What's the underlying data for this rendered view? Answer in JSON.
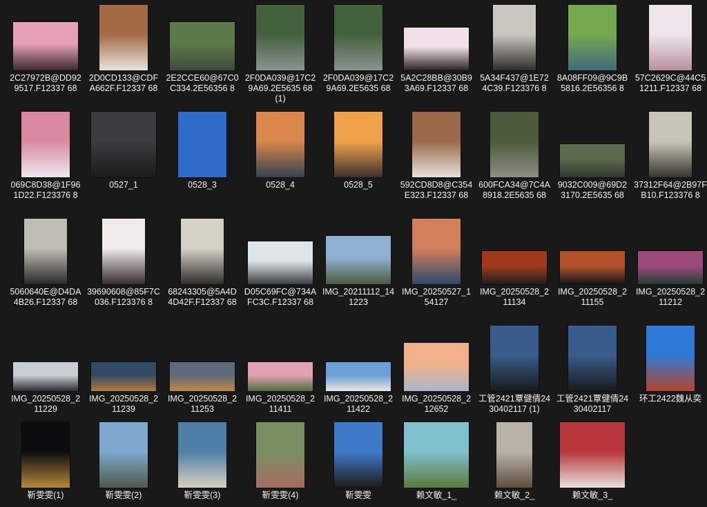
{
  "files": [
    {
      "name": "2C27972B@DD929517.F12337 68",
      "thumb": "photo-thumbnail",
      "colors": [
        "#e7a1b5",
        "#3a2a2a"
      ]
    },
    {
      "name": "2D0CD133@CDFA662F.F12337 68",
      "thumb": "photo-thumbnail",
      "colors": [
        "#a36a45",
        "#e9e3dc"
      ]
    },
    {
      "name": "2E2CCE60@67C0C334.2E56356 8",
      "thumb": "photo-thumbnail",
      "colors": [
        "#5d7a4a",
        "#3f4b3b"
      ]
    },
    {
      "name": "2F0DA039@17C29A69.2E5635 68 (1)",
      "thumb": "photo-thumbnail",
      "colors": [
        "#44613d",
        "#8a938e"
      ]
    },
    {
      "name": "2F0DA039@17C29A69.2E5635 68",
      "thumb": "photo-thumbnail",
      "colors": [
        "#44613d",
        "#8a938e"
      ]
    },
    {
      "name": "5A2C28BB@30B93A69.F12337 68",
      "thumb": "photo-thumbnail",
      "colors": [
        "#f3dfe7",
        "#2c2426"
      ]
    },
    {
      "name": "5A34F437@1E724C39.F123376 8",
      "thumb": "photo-thumbnail",
      "colors": [
        "#c9c7bf",
        "#2e2e2c"
      ]
    },
    {
      "name": "8A08FF09@9C9B5816.2E56356 8",
      "thumb": "photo-thumbnail",
      "colors": [
        "#76a84f",
        "#3f6b7a"
      ]
    },
    {
      "name": "57C2629C@44C51211.F12337 68",
      "thumb": "photo-thumbnail",
      "colors": [
        "#eee6ea",
        "#b98fa0"
      ]
    },
    {
      "name": "069C8D38@1F961D22.F123376 8",
      "thumb": "photo-thumbnail",
      "colors": [
        "#d98aa0",
        "#efe8ef"
      ]
    },
    {
      "name": "0527_1",
      "thumb": "photo-thumbnail",
      "colors": [
        "#3a3c3d",
        "#1a1b1b"
      ]
    },
    {
      "name": "0528_3",
      "thumb": "photo-thumbnail",
      "colors": [
        "#2f6bc8",
        "#2f6bc8"
      ]
    },
    {
      "name": "0528_4",
      "thumb": "photo-thumbnail",
      "colors": [
        "#d9874a",
        "#34424f"
      ]
    },
    {
      "name": "0528_5",
      "thumb": "photo-thumbnail",
      "colors": [
        "#f0a24a",
        "#3c3030"
      ]
    },
    {
      "name": "592CD8D8@C354E323.F12337 68",
      "thumb": "photo-thumbnail",
      "colors": [
        "#9b6a4a",
        "#e6e1dc"
      ]
    },
    {
      "name": "600FCA34@7C4A8918.2E5635 68",
      "thumb": "photo-thumbnail",
      "colors": [
        "#4e5a3c",
        "#8b8f84"
      ]
    },
    {
      "name": "9032C009@69D23170.2E5635 68",
      "thumb": "photo-thumbnail",
      "colors": [
        "#5c6a4d",
        "#2f3830"
      ]
    },
    {
      "name": "37312F64@2B97FB10.F123376 8",
      "thumb": "photo-thumbnail",
      "colors": [
        "#c9c4b9",
        "#35362f"
      ]
    },
    {
      "name": "5060640E@D4DA4B26.F12337 68",
      "thumb": "photo-thumbnail",
      "colors": [
        "#c0bdb4",
        "#2a2a28"
      ]
    },
    {
      "name": "39690608@85F7C036.F123376 8",
      "thumb": "photo-thumbnail",
      "colors": [
        "#f1ebea",
        "#392d31"
      ]
    },
    {
      "name": "68243305@5A4D4D42F.F12337 68",
      "thumb": "photo-thumbnail",
      "colors": [
        "#d6d1c6",
        "#2f2e2b"
      ]
    },
    {
      "name": "D05C69FC@734AFC3C.F12337 68",
      "thumb": "photo-thumbnail",
      "colors": [
        "#dfe6ea",
        "#3b4045"
      ]
    },
    {
      "name": "IMG_20211112_141223",
      "thumb": "photo-thumbnail",
      "colors": [
        "#8fb0d2",
        "#4c5b3c"
      ]
    },
    {
      "name": "IMG_20250527_154127",
      "thumb": "photo-thumbnail",
      "colors": [
        "#d47f5b",
        "#2b4a6a"
      ]
    },
    {
      "name": "IMG_20250528_211134",
      "thumb": "photo-thumbnail",
      "colors": [
        "#a03a1a",
        "#1f1b20"
      ]
    },
    {
      "name": "IMG_20250528_211155",
      "thumb": "photo-thumbnail",
      "colors": [
        "#b4532a",
        "#14161c"
      ]
    },
    {
      "name": "IMG_20250528_211212",
      "thumb": "photo-thumbnail",
      "colors": [
        "#9d4b7c",
        "#233b34"
      ]
    },
    {
      "name": "IMG_20250528_211229",
      "thumb": "photo-thumbnail",
      "colors": [
        "#c9ced4",
        "#2a2d31"
      ]
    },
    {
      "name": "IMG_20250528_211239",
      "thumb": "photo-thumbnail",
      "colors": [
        "#334a66",
        "#b27a3a"
      ]
    },
    {
      "name": "IMG_20250528_211253",
      "thumb": "photo-thumbnail",
      "colors": [
        "#5e6b7a",
        "#c08845"
      ]
    },
    {
      "name": "IMG_20250528_211411",
      "thumb": "photo-thumbnail",
      "colors": [
        "#e39fb3",
        "#4d6f3b"
      ]
    },
    {
      "name": "IMG_20250528_211422",
      "thumb": "photo-thumbnail",
      "colors": [
        "#6da0d6",
        "#e9e6e0"
      ]
    },
    {
      "name": "IMG_20250528_212652",
      "thumb": "photo-thumbnail",
      "colors": [
        "#f1b18a",
        "#a8b6cf"
      ]
    },
    {
      "name": "工管2421覃健倩2430402117 (1)",
      "thumb": "photo-thumbnail",
      "colors": [
        "#3a5c8c",
        "#181a1d"
      ]
    },
    {
      "name": "工管2421覃健倩2430402117",
      "thumb": "photo-thumbnail",
      "colors": [
        "#3a5c8c",
        "#181a1d"
      ]
    },
    {
      "name": "环工2422魏从奕",
      "thumb": "photo-thumbnail",
      "colors": [
        "#2f7ad6",
        "#b4452c"
      ]
    },
    {
      "name": "靳雯雯(1)",
      "thumb": "photo-thumbnail",
      "colors": [
        "#0c0c0e",
        "#b48a3c"
      ]
    },
    {
      "name": "靳雯雯(2)",
      "thumb": "photo-thumbnail",
      "colors": [
        "#7fa8cf",
        "#4d5a4b"
      ]
    },
    {
      "name": "靳雯雯(3)",
      "thumb": "photo-thumbnail",
      "colors": [
        "#4f7fa7",
        "#d8d1bf"
      ]
    },
    {
      "name": "靳雯雯(4)",
      "thumb": "photo-thumbnail",
      "colors": [
        "#7a8f61",
        "#a46d64"
      ]
    },
    {
      "name": "靳雯雯",
      "thumb": "photo-thumbnail",
      "colors": [
        "#3d7bc9",
        "#201a18"
      ]
    },
    {
      "name": "赖文敏_1_",
      "thumb": "photo-thumbnail",
      "colors": [
        "#7fc1cd",
        "#5b7a3d"
      ]
    },
    {
      "name": "赖文敏_2_",
      "thumb": "photo-thumbnail",
      "colors": [
        "#b9b2a8",
        "#5e4d3e"
      ]
    },
    {
      "name": "赖文敏_3_",
      "thumb": "photo-thumbnail",
      "colors": [
        "#b8373a",
        "#e7e0dc"
      ]
    }
  ]
}
